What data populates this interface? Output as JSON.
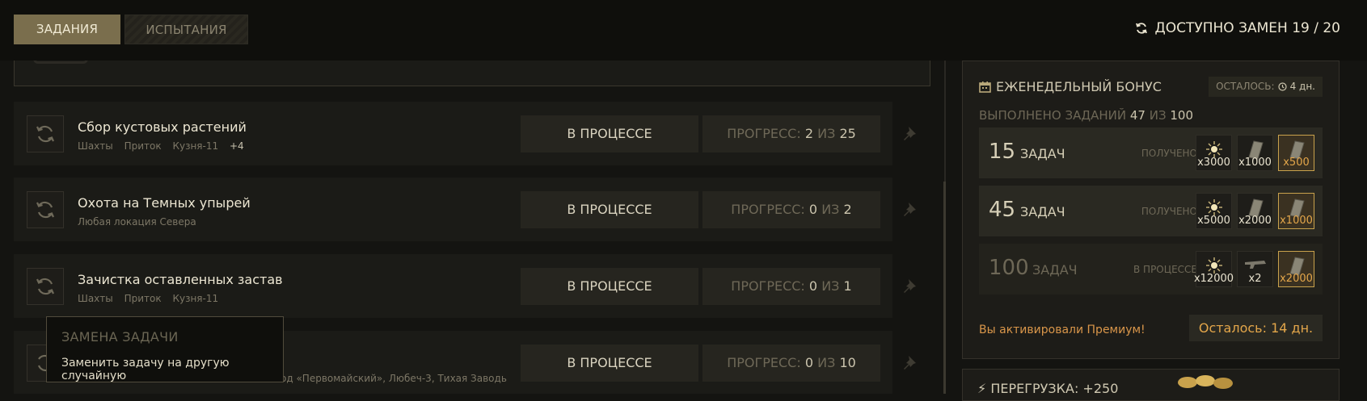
{
  "tabs": [
    {
      "label": "ЗАДАНИЯ",
      "active": true
    },
    {
      "label": "ИСПЫТАНИЯ",
      "active": false
    }
  ],
  "swaps": {
    "label": "ДОСТУПНО ЗАМЕН 19 / 20",
    "icon": "refresh-icon"
  },
  "quests": [
    {
      "title": "Сбор кустовых растений",
      "locations": [
        "Шахты",
        "Приток",
        "Кузня-11"
      ],
      "more": "+4",
      "status": "В ПРОЦЕССЕ",
      "progress_label": "ПРОГРЕСС:",
      "progress_current": "2",
      "progress_of": "ИЗ",
      "progress_total": "25"
    },
    {
      "title": "Охота на Темных упырей",
      "locations": [
        "Любая локация Севера"
      ],
      "more": "",
      "status": "В ПРОЦЕССЕ",
      "progress_label": "ПРОГРЕСС:",
      "progress_current": "0",
      "progress_of": "ИЗ",
      "progress_total": "2"
    },
    {
      "title": "Зачистка оставленных застав",
      "locations": [
        "Шахты",
        "Приток",
        "Кузня-11"
      ],
      "more": "",
      "status": "В ПРОЦЕССЕ",
      "progress_label": "ПРОГРЕСС:",
      "progress_current": "0",
      "progress_of": "ИЗ",
      "progress_total": "1"
    },
    {
      "title": "",
      "locations_text": "од «Первомайский», Любеч-3, Тихая Заводь",
      "status": "В ПРОЦЕССЕ",
      "progress_label": "ПРОГРЕСС:",
      "progress_current": "0",
      "progress_of": "ИЗ",
      "progress_total": "10"
    }
  ],
  "tooltip": {
    "title": "ЗАМЕНА ЗАДАЧИ",
    "text": "Заменить задачу на другую случайную"
  },
  "weekly": {
    "title": "ЕЖЕНЕДЕЛЬНЫЙ БОНУС",
    "time_left_label": "ОСТАЛОСЬ:",
    "time_left_value": "4 дн.",
    "done_label": "ВЫПОЛНЕНО ЗАДАНИЙ",
    "done_count": "47",
    "done_of": "ИЗ",
    "done_total": "100",
    "tiers": [
      {
        "count": "15",
        "label": "ЗАДАЧ",
        "state": "ПОЛУЧЕНО",
        "rewards": [
          {
            "icon": "sun-orb-icon",
            "amount": "x3000",
            "highlight": false
          },
          {
            "icon": "plate-icon",
            "amount": "x1000",
            "highlight": false
          },
          {
            "icon": "plate-icon",
            "amount": "x500",
            "highlight": true
          }
        ]
      },
      {
        "count": "45",
        "label": "ЗАДАЧ",
        "state": "ПОЛУЧЕНО",
        "rewards": [
          {
            "icon": "sun-orb-icon",
            "amount": "x5000",
            "highlight": false
          },
          {
            "icon": "plate-icon",
            "amount": "x2000",
            "highlight": false
          },
          {
            "icon": "plate-icon",
            "amount": "x1000",
            "highlight": true
          }
        ]
      },
      {
        "count": "100",
        "label": "ЗАДАЧ",
        "state": "В ПРОЦЕССЕ",
        "rewards": [
          {
            "icon": "sun-orb-icon",
            "amount": "x12000",
            "highlight": false
          },
          {
            "icon": "gun-icon",
            "amount": "x2",
            "highlight": false
          },
          {
            "icon": "plate-icon",
            "amount": "x2000",
            "highlight": true
          }
        ]
      }
    ],
    "premium_text": "Вы активировали Премиум!",
    "premium_left": "Осталось: 14 дн."
  },
  "overload": {
    "label": "ПЕРЕГРУЗКА: +250"
  },
  "colors": {
    "accent": "#7a6e4d",
    "premium": "#e3a64a",
    "background": "#141411"
  }
}
